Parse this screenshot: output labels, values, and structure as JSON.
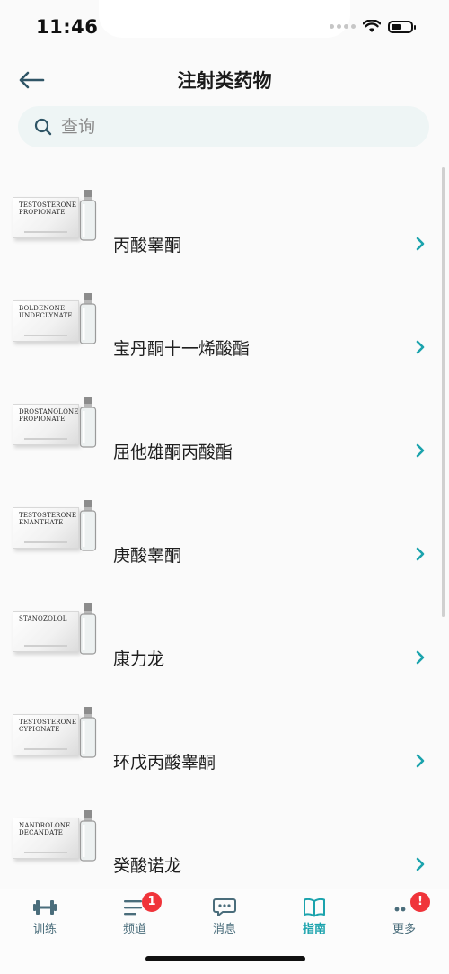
{
  "status_bar": {
    "time": "11:46"
  },
  "header": {
    "title": "注射类药物"
  },
  "search": {
    "placeholder": "查询"
  },
  "items": [
    {
      "label": "丙酸睾酮",
      "box_text": "TESTOSTERONE PROPIONATE"
    },
    {
      "label": "宝丹酮十一烯酸酯",
      "box_text": "BOLDENONE UNDECLYNATE"
    },
    {
      "label": "屈他雄酮丙酸酯",
      "box_text": "DROSTANOLONE PROPIONATE"
    },
    {
      "label": "庚酸睾酮",
      "box_text": "TESTOSTERONE ENANTHATE"
    },
    {
      "label": "康力龙",
      "box_text": "STANOZOLOL"
    },
    {
      "label": "环戊丙酸睾酮",
      "box_text": "TESTOSTERONE CYPIONATE"
    },
    {
      "label": "癸酸诺龙",
      "box_text": "NANDROLONE DECANDATE"
    }
  ],
  "tabs": [
    {
      "label": "训练",
      "icon": "dumbbell-icon"
    },
    {
      "label": "频道",
      "icon": "list-icon",
      "badge": "1"
    },
    {
      "label": "消息",
      "icon": "chat-bubble-icon"
    },
    {
      "label": "指南",
      "icon": "book-icon",
      "active": true
    },
    {
      "label": "更多",
      "icon": "more-dots-icon",
      "badge": "!"
    }
  ],
  "colors": {
    "accent": "#1ba3ad",
    "tab_inactive": "#4a6d7b",
    "badge": "#f0343a",
    "search_bg": "#eef5f5"
  }
}
